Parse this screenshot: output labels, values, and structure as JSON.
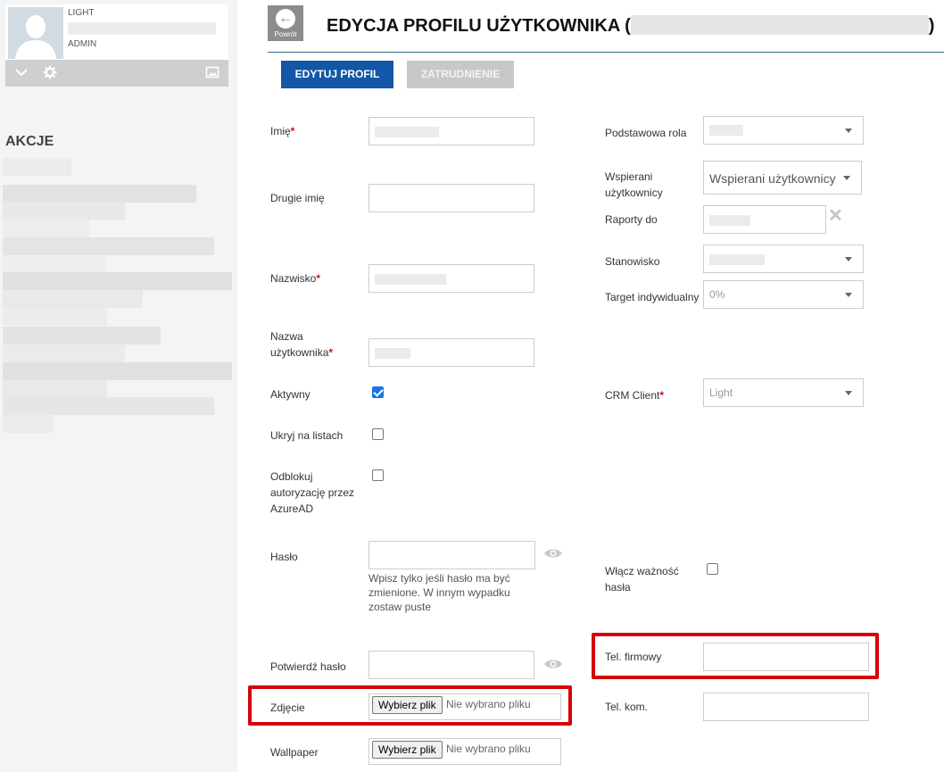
{
  "sidebar": {
    "user": {
      "role_top": "LIGHT",
      "role_bottom": "ADMIN"
    },
    "icons": [
      "chevron-down-icon",
      "gear-icon",
      "image-icon"
    ],
    "actions_heading": "AKCJE"
  },
  "header": {
    "back_label": "Powrót",
    "title_prefix": "EDYCJA PROFILU UŻYTKOWNIKA (",
    "title_suffix": ")"
  },
  "tabs": [
    {
      "label": "EDYTUJ PROFIL",
      "active": true
    },
    {
      "label": "ZATRUDNIENIE",
      "active": false
    }
  ],
  "form": {
    "first_name": {
      "label": "Imię",
      "required": "*"
    },
    "middle_name": {
      "label": "Drugie imię",
      "value": ""
    },
    "last_name": {
      "label": "Nazwisko",
      "required": "*"
    },
    "username": {
      "label_line1": "Nazwa",
      "label_line2": "użytkownika",
      "required": "*"
    },
    "active": {
      "label": "Aktywny",
      "checked": true
    },
    "hide_lists": {
      "label": "Ukryj na listach",
      "checked": false
    },
    "azure": {
      "label_line1": "Odblokuj",
      "label_line2": "autoryzację przez",
      "label_line3": "AzureAD",
      "checked": false
    },
    "password": {
      "label": "Hasło",
      "value": "",
      "hint_line1": "Wpisz tylko jeśli hasło ma być",
      "hint_line2": "zmienione. W innym wypadku",
      "hint_line3": "zostaw puste"
    },
    "confirm_password": {
      "label": "Potwierdź hasło",
      "value": ""
    },
    "photo": {
      "label": "Zdjęcie",
      "button": "Wybierz plik",
      "status": "Nie wybrano pliku"
    },
    "wallpaper": {
      "label": "Wallpaper",
      "button": "Wybierz plik",
      "status": "Nie wybrano pliku"
    },
    "primary_role": {
      "label": "Podstawowa rola"
    },
    "supported_users": {
      "label_line1": "Wspierani",
      "label_line2": "użytkownicy",
      "placeholder": "Wspierani użytkownicy"
    },
    "reports_to": {
      "label": "Raporty do"
    },
    "position": {
      "label": "Stanowisko"
    },
    "target": {
      "label": "Target indywidualny",
      "value": "0%"
    },
    "crm_client": {
      "label": "CRM Client",
      "required": "*",
      "value": "Light"
    },
    "password_expiry": {
      "label_line1": "Włącz ważność",
      "label_line2": "hasła",
      "checked": false
    },
    "company_phone": {
      "label": "Tel. firmowy",
      "value": ""
    },
    "mobile_phone": {
      "label": "Tel. kom.",
      "value": ""
    }
  },
  "colors": {
    "primary": "#1357a6",
    "highlight": "#d6000c",
    "required": "#d01010",
    "checkbox": "#1a73e8"
  }
}
